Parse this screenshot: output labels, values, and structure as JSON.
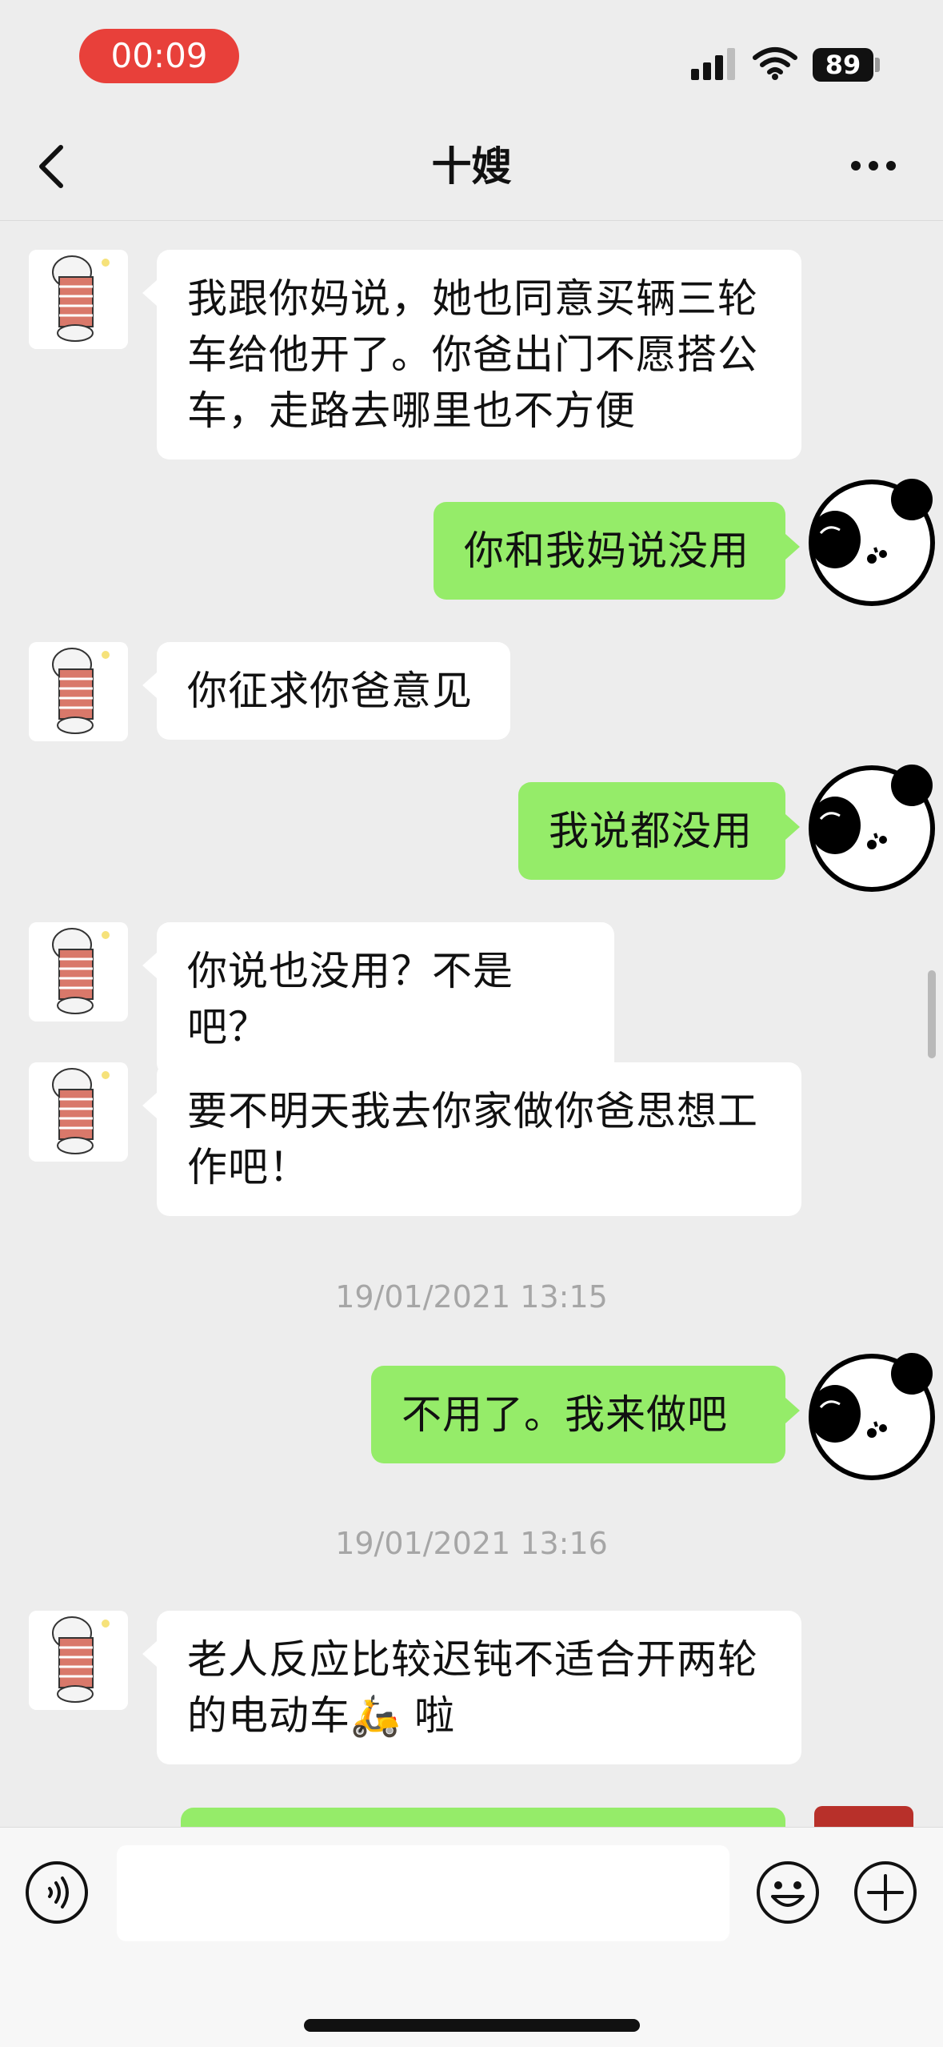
{
  "status_bar": {
    "time": "00:09",
    "battery": "89"
  },
  "header": {
    "title": "十嫂"
  },
  "messages": [
    {
      "side": "in",
      "text": "我跟你妈说，她也同意买辆三轮车给他开了。你爸出门不愿搭公车，走路去哪里也不方便"
    },
    {
      "side": "out",
      "text": "你和我妈说没用"
    },
    {
      "side": "in",
      "text": "你征求你爸意见"
    },
    {
      "side": "out",
      "text": "我说都没用"
    },
    {
      "side": "in",
      "text": "你说也没用？不是吧？"
    },
    {
      "side": "in",
      "text": "要不明天我去你家做你爸思想工作吧！"
    },
    {
      "side": "out",
      "text": "不用了。我来做吧"
    },
    {
      "side": "in",
      "text": "老人反应比较迟钝不适合开两轮的电动车🛵 啦"
    }
  ],
  "timestamps": [
    "19/01/2021 13:15",
    "19/01/2021 13:16"
  ],
  "input": {
    "placeholder": ""
  },
  "icons": {
    "back": "chevron-left-icon",
    "more": "more-dots-icon",
    "voice": "voice-icon",
    "emoji": "emoji-icon",
    "plus": "plus-icon",
    "signal": "signal-icon",
    "wifi": "wifi-icon"
  },
  "colors": {
    "outgoing_bubble": "#95ec69",
    "incoming_bubble": "#ffffff",
    "background": "#ededed",
    "time_pill": "#e8403a"
  }
}
